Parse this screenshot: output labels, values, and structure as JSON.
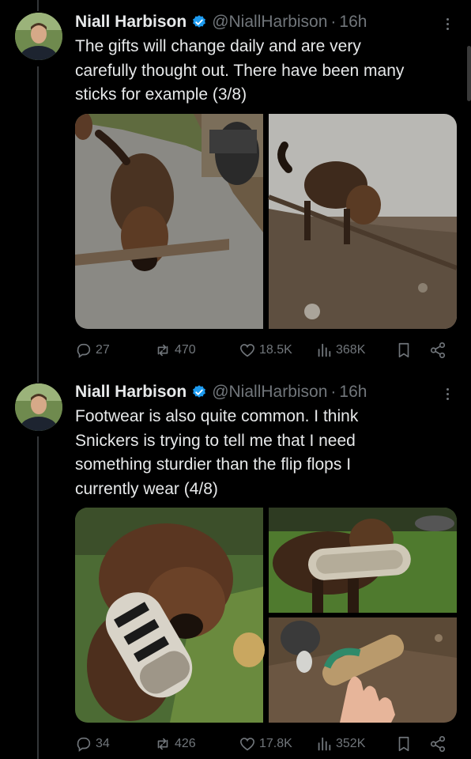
{
  "theme": {
    "background": "#000000",
    "text": "#e7e9ea",
    "muted": "#71767b",
    "verified": "#1d9bf0"
  },
  "tweets": [
    {
      "name": "Niall Harbison",
      "handle": "@NiallHarbison",
      "dot": "·",
      "time": "16h",
      "text_lines": [
        "The gifts will change daily and are very",
        "carefully thought out. There have been many",
        "sticks for example (3/8)"
      ],
      "replies": "27",
      "reposts": "470",
      "likes": "18.5K",
      "views": "368K",
      "media": [
        "dog-with-stick-on-road",
        "dog-with-long-stick-in-dirt"
      ]
    },
    {
      "name": "Niall Harbison",
      "handle": "@NiallHarbison",
      "dot": "·",
      "time": "16h",
      "text_lines": [
        "Footwear is also quite common. I think",
        "Snickers is trying to tell me that I need",
        "something sturdier than the flip flops I",
        "currently wear (4/8)"
      ],
      "replies": "34",
      "reposts": "426",
      "likes": "17.8K",
      "views": "352K",
      "media": [
        "dog-chewing-sneaker",
        "dog-holding-shoe-sole",
        "hand-holding-green-sandal"
      ]
    }
  ],
  "icons": {
    "verified": "verified-badge-icon",
    "more": "more-options-icon",
    "reply": "reply-icon",
    "repost": "repost-icon",
    "like": "heart-icon",
    "views": "views-chart-icon",
    "bookmark": "bookmark-icon",
    "share": "share-icon"
  }
}
